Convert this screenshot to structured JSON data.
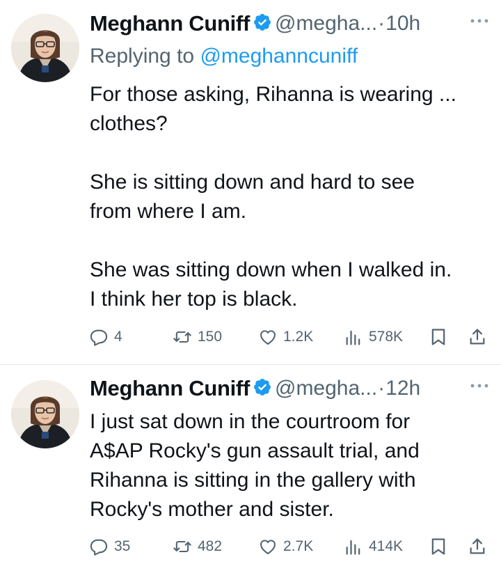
{
  "tweets": [
    {
      "author_name": "Meghann Cuniff",
      "handle": "@megha...",
      "separator": "·",
      "time": "10h",
      "replying_label": "Replying to",
      "replying_to": "@meghanncuniff",
      "text": "For those asking, Rihanna is wearing ...\nclothes?\n\nShe is sitting down and hard to see\nfrom where I am.\n\nShe was sitting down when I walked in.\nI think her top is black.",
      "replies": "4",
      "reposts": "150",
      "likes": "1.2K",
      "views": "578K"
    },
    {
      "author_name": "Meghann Cuniff",
      "handle": "@megha...",
      "separator": "·",
      "time": "12h",
      "text": "I just sat down in the courtroom for\nA$AP Rocky's gun assault trial, and\nRihanna is sitting in the gallery with\nRocky's mother and sister.",
      "replies": "35",
      "reposts": "482",
      "likes": "2.7K",
      "views": "414K"
    }
  ],
  "colors": {
    "text": "#0f1419",
    "secondary": "#536471",
    "accent": "#1d9bf0",
    "divider": "#e4e8ea"
  },
  "icons": [
    "verified-badge-icon",
    "more-icon",
    "reply-icon",
    "repost-icon",
    "like-icon",
    "views-icon",
    "bookmark-icon",
    "share-icon"
  ]
}
